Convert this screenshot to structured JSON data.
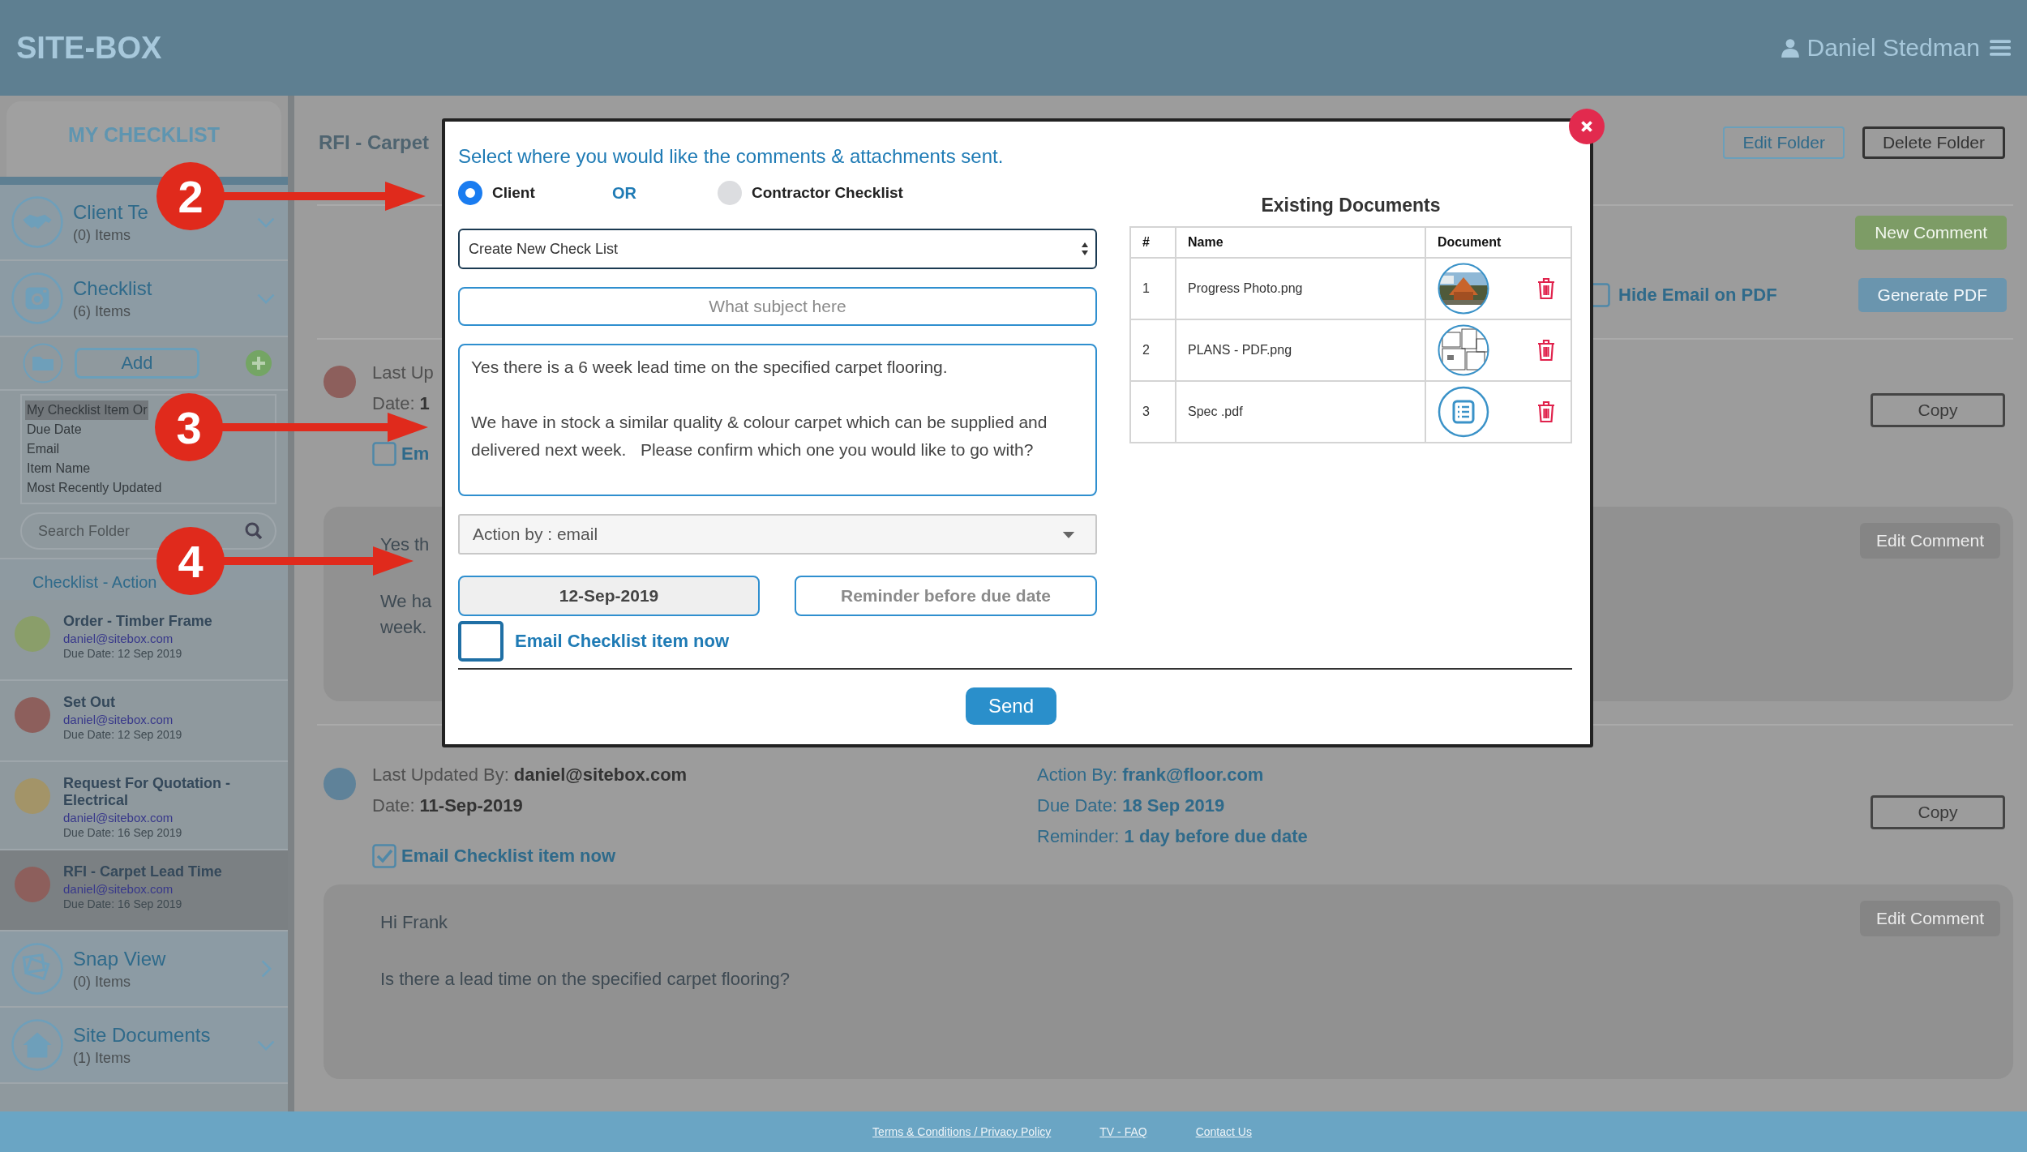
{
  "header": {
    "logo": "SITE-BOX",
    "user_name": "Daniel Stedman"
  },
  "sidebar": {
    "title": "MY CHECKLIST",
    "top_sections": [
      {
        "title": "Client Te",
        "count": "(0) Items",
        "expanded": true
      },
      {
        "title": "Checklist",
        "count": "(6) Items",
        "expanded": true
      }
    ],
    "add_button": "Add",
    "sort_options": [
      {
        "label": "My Checklist Item Or",
        "selected": true
      },
      {
        "label": "Due Date",
        "selected": false
      },
      {
        "label": "Email",
        "selected": false
      },
      {
        "label": "Item Name",
        "selected": false
      },
      {
        "label": "Most Recently Updated",
        "selected": false
      }
    ],
    "search": {
      "placeholder": "Search Folder"
    },
    "action_items": {
      "title": "Checklist - Action",
      "items": [
        {
          "title": "Order - Timber Frame",
          "email": "daniel@sitebox.com",
          "due": "Due Date: 12 Sep 2019",
          "color": "#8a9e6a",
          "selected": false
        },
        {
          "title": "Set Out",
          "email": "daniel@sitebox.com",
          "due": "Due Date: 12 Sep 2019",
          "color": "#8d5f5c",
          "selected": false
        },
        {
          "title": "Request For Quotation - Electrical",
          "email": "daniel@sitebox.com",
          "due": "Due Date: 16 Sep 2019",
          "color": "#a39468",
          "selected": false
        },
        {
          "title": "RFI - Carpet Lead Time",
          "email": "daniel@sitebox.com",
          "due": "Due Date: 16 Sep 2019",
          "color": "#8d5f5c",
          "selected": true
        }
      ]
    },
    "bottom_sections": [
      {
        "title": "Snap View",
        "count": "(0) Items",
        "expanded": false
      },
      {
        "title": "Site Documents",
        "count": "(1) Items",
        "expanded": true
      }
    ]
  },
  "main": {
    "title": "RFI - Carpet",
    "folder_buttons": [
      {
        "label": "Edit Folder",
        "kind": "light"
      },
      {
        "label": "Delete Folder",
        "kind": "dark"
      }
    ],
    "new_comment_button": "New Comment",
    "hide_email": {
      "label": "Hide Email on PDF",
      "checked": false
    },
    "generate_pdf_button": "Generate PDF",
    "entries": [
      {
        "color": "#8d5f5c",
        "updated": {
          "label": "Last Up"
        },
        "date": {
          "label": "Date:",
          "value": "1"
        },
        "email_now": {
          "label": "Em",
          "checked": false
        },
        "copy_button": "Copy",
        "comment": {
          "paragraphs": [
            [
              "Yes th"
            ],
            [
              "We ha",
              "week."
            ]
          ],
          "edit_button": "Edit Comment"
        }
      },
      {
        "color": "#5f8299",
        "updated": {
          "label": "Last Updated By:",
          "value": "daniel@sitebox.com"
        },
        "date": {
          "label": "Date:",
          "value": "11-Sep-2019"
        },
        "email_now": {
          "label": "Email Checklist item now",
          "checked": true
        },
        "details": [
          {
            "label": "Action By:",
            "value": "frank@floor.com"
          },
          {
            "label": "Due Date:",
            "value": "18 Sep 2019"
          },
          {
            "label": "Reminder:",
            "value": "1 day before due date"
          }
        ],
        "copy_button": "Copy",
        "comment": {
          "paragraphs": [
            [
              "Hi Frank"
            ],
            [
              "Is there a lead time on the specified carpet flooring?"
            ]
          ],
          "edit_button": "Edit Comment"
        }
      }
    ]
  },
  "modal": {
    "prompt": "Select where you would like the comments & attachments sent.",
    "radios": [
      {
        "label": "Client",
        "selected": true
      },
      {
        "label": "Contractor Checklist",
        "selected": false
      }
    ],
    "or_label": "OR",
    "checklist_select": "Create New Check List",
    "subject": {
      "placeholder": "What subject here"
    },
    "message": "Yes there is a 6 week lead time on the specified carpet flooring.\n\nWe have in stock a similar quality & colour carpet which can be supplied and delivered next week.   Please confirm which one you would like to go with?",
    "action_select": "Action by : email",
    "due_date": "12-Sep-2019",
    "reminder": {
      "placeholder": "Reminder before due date"
    },
    "email_now": {
      "label": "Email Checklist item now",
      "checked": false
    },
    "send_button": "Send",
    "documents": {
      "title": "Existing Documents",
      "columns": [
        "#",
        "Name",
        "Document"
      ],
      "rows": [
        {
          "num": "1",
          "name": "Progress Photo.png"
        },
        {
          "num": "2",
          "name": "PLANS - PDF.png",
          "kind": "plan"
        },
        {
          "num": "3",
          "name": "Spec .pdf",
          "kind": "file"
        }
      ]
    }
  },
  "annotations": [
    {
      "label": "2"
    },
    {
      "label": "3"
    },
    {
      "label": "4"
    }
  ],
  "footer": {
    "links": [
      "Terms & Conditions / Privacy Policy",
      "TV - FAQ",
      "Contact Us"
    ]
  }
}
